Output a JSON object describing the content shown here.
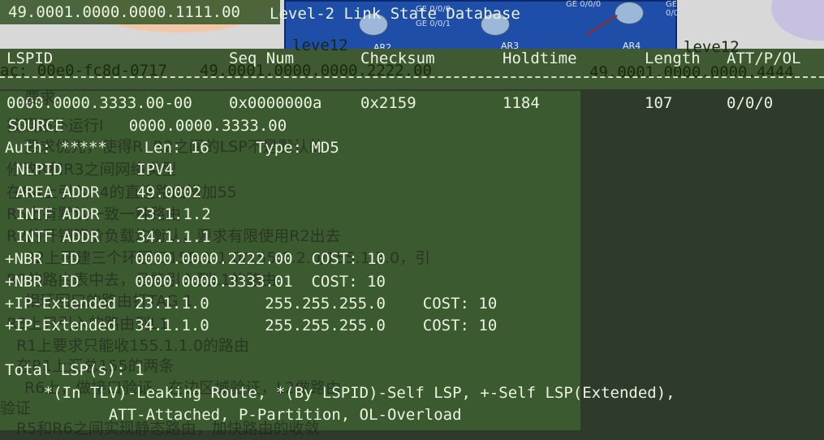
{
  "window": {
    "title": "Level-2 Link State Database",
    "bg_net_left": "49.0001.0000.0000.1111.00",
    "bg_level_left": "leve12",
    "bg_level_right": "leve12",
    "bg_mac": "ac: 00e0-fc8d-0717",
    "bg_net_mid": "49.0001.0000.0000.2222.00",
    "bg_net_right": "49.0001.0000.0000.4444"
  },
  "topology": {
    "routers": [
      "AR2",
      "AR3",
      "AR4"
    ],
    "interfaces": [
      "GE 0/0/0",
      "GE 0/0/1",
      "GE 0/0/0",
      "GE 0/0/1"
    ]
  },
  "table": {
    "headers": {
      "lspid": "LSPID",
      "seq": "Seq Num",
      "checksum": "Checksum",
      "holdtime": "Holdtime",
      "length": "Length",
      "flags": "ATT/P/OL"
    },
    "row": {
      "lspid": "0000.0000.3333.00-00",
      "seq": "0x0000000a",
      "checksum": "0x2159",
      "holdtime": "1184",
      "length": "107",
      "flags": "0/0/0"
    }
  },
  "details": [
    "SOURCE       0000.0000.3333.00",
    "Auth: *****    Len: 16     Type: MD5",
    " NLPID        IPV4",
    " AREA ADDR    49.0002",
    " INTF ADDR    23.1.1.2",
    " INTF ADDR    34.1.1.1",
    "+NBR  ID      0000.0000.2222.00  COST: 10",
    "+NBR  ID      0000.0000.3333.01  COST: 10",
    "+IP-Extended  23.1.1.0      255.255.255.0    COST: 10",
    "+IP-Extended  34.1.1.0      255.255.255.0    COST: 10"
  ],
  "footer": {
    "total": "Total LSP(s): 1",
    "legend1": "    *(In TLV)-Leaking Route, *(By LSPID)-Self LSP, +-Self LSP(Extended),",
    "legend2": "           ATT-Attached, P-Partition, OL-Overload"
  },
  "overlay_notes": [
    "要求",
    "按照拓扑运行I",
    "要求优先，使得R  R2之间的LSP不是默认的",
    "修改R和R3之间网络类型",
    "在R4上引入R4的直连路由增加55",
    "R5上有默认一致一种路由",
    "R2的开销等价负载均衡认，要求有限使用R2出去",
    "R2上要建三个环回口155.1.1.0/155.1.2.0/155.1.3.0，引",
    "R2的路由表中去，且能引入到L1的路由",
    "相环回口的路由打TAG 1",
    "R3上只引入的路由到L1",
    "R1上要求只能收155.1.1.0的路由",
    "在R1上汇总155的两条",
    "R6上，做接口验证，在边区域验证，L2做路由",
    "验证",
    "R5和R6之间实现静态路由，加快路由的收敛"
  ]
}
